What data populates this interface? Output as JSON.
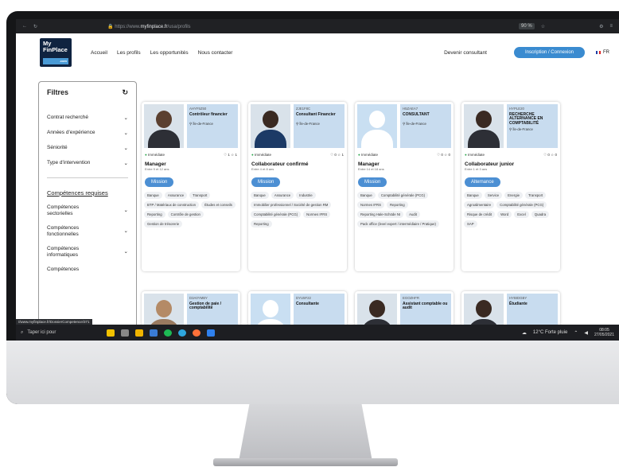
{
  "browser": {
    "url_prefix": "https://www.",
    "url_domain": "myfinplace.fr",
    "url_path": "/usa/profils",
    "zoom": "90 %"
  },
  "header": {
    "logo_line1": "My",
    "logo_line2": "FinPlace",
    "logo_sub": ".com",
    "nav": [
      "Accueil",
      "Les profils",
      "Les opportunités",
      "Nous contacter"
    ],
    "become": "Devenir consultant",
    "cta": "Inscription / Connexion",
    "lang": "FR"
  },
  "filters": {
    "title": "Filtres",
    "rows": [
      "Contrat recherché",
      "Années d'expérience",
      "Séniorité",
      "Type d'intervention"
    ],
    "comp_title": "Compétences requises",
    "comp": [
      "Compétences sectorielles",
      "Compétences fonctionnelles",
      "Compétences informatiques",
      "Compétences"
    ]
  },
  "cards": [
    {
      "ref": "AHYF5Z50",
      "title": "Contrôleur financier",
      "loc": "Île-de-France",
      "status": "Immédiate",
      "likes": "1",
      "stars": "1",
      "role": "Manager",
      "exp": "Entre 9 et 12 ans",
      "btn": "Mission",
      "tags": [
        "Banque",
        "Assurance",
        "Transport",
        "BTP / Matériaux de construction",
        "Études et conseils",
        "Reporting",
        "Contrôle de gestion",
        "Gestion de trésorerie"
      ]
    },
    {
      "ref": "ZJE1F8C",
      "title": "Consultant Financier",
      "loc": "Île-de-France",
      "status": "Immédiate",
      "likes": "0",
      "stars": "1",
      "role": "Collaborateur confirmé",
      "exp": "Entre 4 et 8 ans",
      "btn": "Mission",
      "tags": [
        "Banque",
        "Assurance",
        "Industrie",
        "Immobilier professionnel / Société de gestion RM",
        "Comptabilité générale (PCG)",
        "Normes IFRS",
        "Reporting"
      ]
    },
    {
      "ref": "H5ZAEA7",
      "title": "CONSULTANT",
      "loc": "Île-de-France",
      "status": "Immédiate",
      "likes": "0",
      "stars": "0",
      "role": "Manager",
      "exp": "Entre 14 et 18 ans",
      "btn": "Mission",
      "tags": [
        "Banque",
        "Comptabilité générale (PCG)",
        "Normes IFRS",
        "Reporting",
        "Reporting Hale-Schöde NI",
        "Audit",
        "Pack office (level expert / intermédiaire / Pratique)"
      ]
    },
    {
      "ref": "HYPLE20",
      "title": "RECHERCHE ALTERNANCE EN COMPTABILITÉ",
      "loc": "Île-de-France",
      "status": "Immédiate",
      "likes": "0",
      "stars": "0",
      "role": "Collaborateur junior",
      "exp": "Entre 1 et 3 ans",
      "btn": "Alternance",
      "tags": [
        "Banque",
        "Service",
        "Energie",
        "Transport",
        "Agroalimentaire",
        "Comptabilité générale (PCG)",
        "Risque de crédit",
        "Word",
        "Excel",
        "Quadra",
        "SAP"
      ]
    }
  ],
  "cards2": [
    {
      "ref": "D3A0YMBY",
      "title": "Gestion de paie / comptabilité"
    },
    {
      "ref": "DYU5F22",
      "title": "Consultante"
    },
    {
      "ref": "EGOZHFR",
      "title": "Assistant comptable ou audit"
    },
    {
      "ref": "HYBIDGBY",
      "title": "Étudiante"
    }
  ],
  "statusurl": "//www.myfinplace.fr/DossierCompetence/371",
  "taskbar": {
    "search": "Taper ici pour",
    "weather": "12°C Forte pluie",
    "time": "08:05",
    "date": "27/05/2021"
  }
}
